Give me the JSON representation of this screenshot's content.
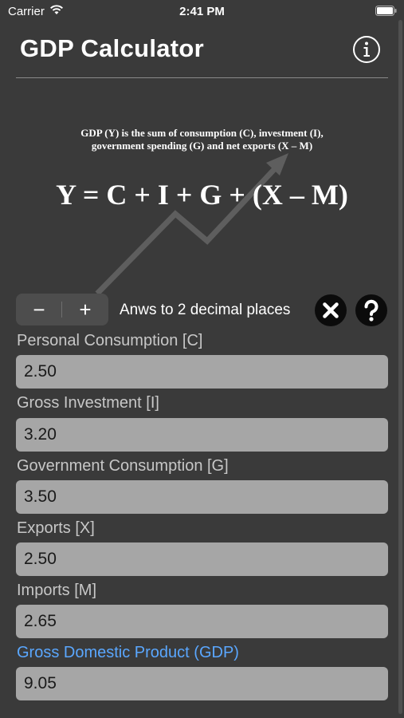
{
  "status_bar": {
    "carrier": "Carrier",
    "time": "2:41 PM"
  },
  "nav": {
    "title": "GDP Calculator",
    "info_icon": "info-circle-icon"
  },
  "banner": {
    "description": "GDP (Y) is the sum of consumption (C), investment (I),\ngovernment spending (G) and net exports (X – M)",
    "equation": "Y = C + I + G + (X – M)"
  },
  "controls": {
    "minus": "−",
    "plus": "+",
    "decimals_label": "Anws to 2 decimal places",
    "clear_icon": "close-circle-icon",
    "help_icon": "question-circle-icon"
  },
  "fields": [
    {
      "label": "Personal Consumption [C]",
      "value": "2.50"
    },
    {
      "label": "Gross Investment [I]",
      "value": "3.20"
    },
    {
      "label": "Government Consumption [G]",
      "value": "3.50"
    },
    {
      "label": "Exports [X]",
      "value": "2.50"
    },
    {
      "label": "Imports [M]",
      "value": "2.65"
    }
  ],
  "result": {
    "label": "Gross Domestic Product (GDP)",
    "value": "9.05"
  },
  "colors": {
    "background": "#3a3a3a",
    "field": "#a6a6a6",
    "result_label": "#5aa7ff"
  }
}
